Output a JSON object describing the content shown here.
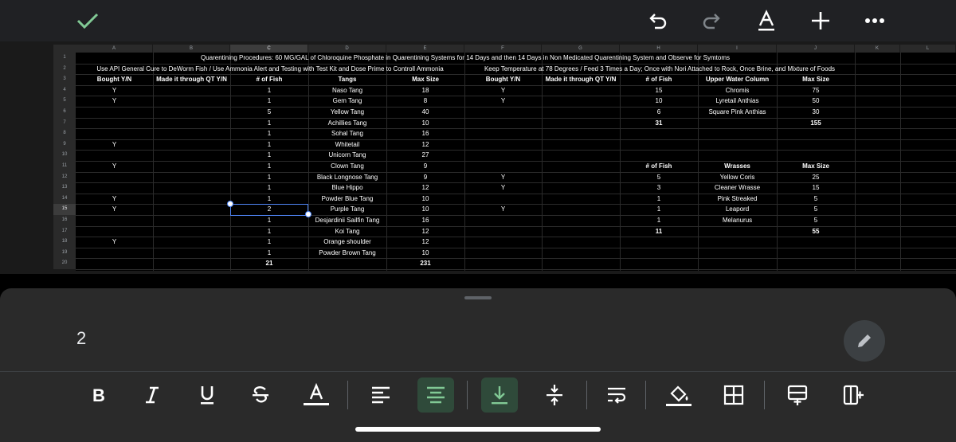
{
  "toolbar_top": {
    "confirm_icon": "checkmark-icon",
    "undo_icon": "undo-icon",
    "redo_icon": "redo-icon",
    "text_format_icon": "text-format-icon",
    "insert_icon": "plus-icon",
    "more_icon": "more-icon"
  },
  "columns": [
    "A",
    "B",
    "C",
    "D",
    "E",
    "F",
    "G",
    "H",
    "I",
    "J",
    "K",
    "L"
  ],
  "rows": [
    "1",
    "2",
    "3",
    "4",
    "5",
    "6",
    "7",
    "8",
    "9",
    "10",
    "11",
    "12",
    "13",
    "14",
    "15",
    "16",
    "17",
    "18",
    "19",
    "20"
  ],
  "sheet": {
    "title_row": "Quarentining Procedures:  60 MG/GAL of Chloroquine Phosphate in Quarentining Systems for 14 Days and then 14 Days in Non Medicated Quarentining System and Observe for Symtoms",
    "note_left": "Use API General Cure to DeWorm Fish / Use Ammonia Alert and Testing with Test Kit and Dose Prime to Controll Ammonia",
    "note_right": "Keep Temperature at 78 Degrees / Feed 3 Times a Day; Once with Nori Attached to Rock, Once Brine, and Mixture of Foods",
    "headers_left": [
      "Bought Y/N",
      "Made it through QT Y/N",
      "# of Fish",
      "Tangs",
      "Max Size"
    ],
    "headers_right": [
      "Bought Y/N",
      "Made it through QT Y/N",
      "# of Fish",
      "Upper Water Column",
      "Max Size"
    ],
    "tangs": [
      {
        "bought": "Y",
        "qt": "",
        "count": "1",
        "name": "Naso Tang",
        "max": "18"
      },
      {
        "bought": "Y",
        "qt": "",
        "count": "1",
        "name": "Gem Tang",
        "max": "8"
      },
      {
        "bought": "",
        "qt": "",
        "count": "5",
        "name": "Yellow Tang",
        "max": "40"
      },
      {
        "bought": "",
        "qt": "",
        "count": "1",
        "name": "Achillies Tang",
        "max": "10"
      },
      {
        "bought": "",
        "qt": "",
        "count": "1",
        "name": "Sohal Tang",
        "max": "16"
      },
      {
        "bought": "Y",
        "qt": "",
        "count": "1",
        "name": "Whitetail",
        "max": "12"
      },
      {
        "bought": "",
        "qt": "",
        "count": "1",
        "name": "Unicorn Tang",
        "max": "27"
      },
      {
        "bought": "Y",
        "qt": "",
        "count": "1",
        "name": "Clown Tang",
        "max": "9"
      },
      {
        "bought": "",
        "qt": "",
        "count": "1",
        "name": "Black Longnose Tang",
        "max": "9"
      },
      {
        "bought": "",
        "qt": "",
        "count": "1",
        "name": "Blue Hippo",
        "max": "12"
      },
      {
        "bought": "Y",
        "qt": "",
        "count": "1",
        "name": "Powder Blue Tang",
        "max": "10"
      },
      {
        "bought": "Y",
        "qt": "",
        "count": "2",
        "name": "Purple Tang",
        "max": "10"
      },
      {
        "bought": "",
        "qt": "",
        "count": "1",
        "name": "Desjardinii Sailfin Tang",
        "max": "16"
      },
      {
        "bought": "",
        "qt": "",
        "count": "1",
        "name": "Koi Tang",
        "max": "12"
      },
      {
        "bought": "Y",
        "qt": "",
        "count": "1",
        "name": "Orange shoulder",
        "max": "12"
      },
      {
        "bought": "",
        "qt": "",
        "count": "1",
        "name": "Powder Brown Tang",
        "max": "10"
      }
    ],
    "tangs_total_count": "21",
    "tangs_total_max": "231",
    "upper": [
      {
        "bought": "Y",
        "count": "15",
        "name": "Chromis",
        "max": "75"
      },
      {
        "bought": "Y",
        "count": "10",
        "name": "Lyretail Anthias",
        "max": "50"
      },
      {
        "bought": "",
        "count": "6",
        "name": "Square Pink Anthias",
        "max": "30"
      }
    ],
    "upper_total_count": "31",
    "upper_total_max": "155",
    "wrasse_headers": [
      "# of Fish",
      "Wrasses",
      "Max Size"
    ],
    "wrasses": [
      {
        "bought": "Y",
        "count": "5",
        "name": "Yellow Coris",
        "max": "25"
      },
      {
        "bought": "Y",
        "count": "3",
        "name": "Cleaner Wrasse",
        "max": "15"
      },
      {
        "bought": "",
        "count": "1",
        "name": "Pink Streaked",
        "max": "5"
      },
      {
        "bought": "Y",
        "count": "1",
        "name": "Leapord",
        "max": "5"
      },
      {
        "bought": "",
        "count": "1",
        "name": "Melanurus",
        "max": "5"
      }
    ],
    "wrasse_total_count": "11",
    "wrasse_total_max": "55",
    "selected_col": "C",
    "selected_row": "15"
  },
  "formula_bar": {
    "value": "2",
    "edit_icon": "pencil-icon"
  },
  "format_toolbar": [
    {
      "name": "bold-button",
      "icon": "bold-icon"
    },
    {
      "name": "italic-button",
      "icon": "italic-icon"
    },
    {
      "name": "underline-button",
      "icon": "underline-icon"
    },
    {
      "name": "strikethrough-button",
      "icon": "strikethrough-icon"
    },
    {
      "name": "text-color-button",
      "icon": "text-color-icon"
    },
    {
      "name": "align-left-button",
      "icon": "align-left-icon"
    },
    {
      "name": "align-center-button",
      "icon": "align-center-icon",
      "active": true
    },
    {
      "name": "valign-bottom-button",
      "icon": "vertical-align-bottom-icon",
      "active": true
    },
    {
      "name": "valign-middle-button",
      "icon": "vertical-align-middle-icon"
    },
    {
      "name": "wrap-text-button",
      "icon": "wrap-text-icon"
    },
    {
      "name": "fill-color-button",
      "icon": "fill-color-icon"
    },
    {
      "name": "borders-button",
      "icon": "borders-icon"
    },
    {
      "name": "insert-row-button",
      "icon": "insert-row-icon"
    },
    {
      "name": "insert-column-button",
      "icon": "insert-column-icon"
    }
  ],
  "colors": {
    "accent_green": "#81c995",
    "selection_blue": "#4f86f7"
  }
}
